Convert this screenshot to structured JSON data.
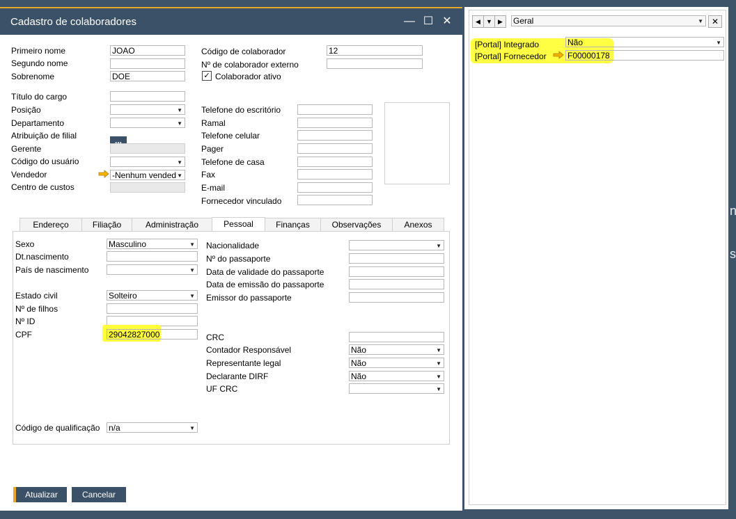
{
  "window": {
    "title": "Cadastro de colaboradores"
  },
  "left_fields": {
    "first_name": {
      "label": "Primeiro nome",
      "value": "JOAO"
    },
    "middle_name": {
      "label": "Segundo nome",
      "value": ""
    },
    "last_name": {
      "label": "Sobrenome",
      "value": "DOE"
    },
    "job_title": {
      "label": "Título do cargo",
      "value": ""
    },
    "position": {
      "label": "Posição",
      "value": ""
    },
    "department": {
      "label": "Departamento",
      "value": ""
    },
    "branch": {
      "label": "Atribuição de filial",
      "button": "..."
    },
    "manager": {
      "label": "Gerente",
      "value": ""
    },
    "user_code": {
      "label": "Código do usuário",
      "value": ""
    },
    "salesperson": {
      "label": "Vendedor",
      "value": "-Nenhum vended"
    },
    "cost_center": {
      "label": "Centro de custos",
      "value": ""
    }
  },
  "right_fields": {
    "employee_code": {
      "label": "Código de colaborador",
      "value": "12"
    },
    "external_no": {
      "label": "Nº de colaborador externo",
      "value": ""
    },
    "active": {
      "label": "Colaborador ativo",
      "checked": true
    },
    "office_phone": {
      "label": "Telefone do escritório",
      "value": ""
    },
    "extension": {
      "label": "Ramal",
      "value": ""
    },
    "mobile": {
      "label": "Telefone celular",
      "value": ""
    },
    "pager": {
      "label": "Pager",
      "value": ""
    },
    "home_phone": {
      "label": "Telefone de casa",
      "value": ""
    },
    "fax": {
      "label": "Fax",
      "value": ""
    },
    "email": {
      "label": "E-mail",
      "value": ""
    },
    "linked_vendor": {
      "label": "Fornecedor vinculado",
      "value": ""
    }
  },
  "tabs": [
    "Endereço",
    "Filiação",
    "Administração",
    "Pessoal",
    "Finanças",
    "Observações",
    "Anexos"
  ],
  "active_tab": "Pessoal",
  "personal_left": {
    "sex": {
      "label": "Sexo",
      "value": "Masculino"
    },
    "birth_date": {
      "label": "Dt.nascimento",
      "value": ""
    },
    "birth_country": {
      "label": "País de nascimento",
      "value": ""
    },
    "marital_status": {
      "label": "Estado civil",
      "value": "Solteiro"
    },
    "children": {
      "label": "Nº de filhos",
      "value": ""
    },
    "id_no": {
      "label": "Nº ID",
      "value": ""
    },
    "cpf": {
      "label": "CPF",
      "value": "29042827000"
    },
    "qualification_code": {
      "label": "Código de qualificação",
      "value": "n/a"
    }
  },
  "personal_right": {
    "nationality": {
      "label": "Nacionalidade",
      "value": ""
    },
    "passport_no": {
      "label": "Nº do passaporte",
      "value": ""
    },
    "passport_expiry": {
      "label": "Data de validade do passaporte",
      "value": ""
    },
    "passport_issue": {
      "label": "Data de emissão do passaporte",
      "value": ""
    },
    "passport_issuer": {
      "label": "Emissor do passaporte",
      "value": ""
    },
    "crc": {
      "label": "CRC",
      "value": ""
    },
    "accountant": {
      "label": "Contador Responsável",
      "value": "Não"
    },
    "legal_rep": {
      "label": "Representante legal",
      "value": "Não"
    },
    "dirf": {
      "label": "Declarante DIRF",
      "value": "Não"
    },
    "uf_crc": {
      "label": "UF CRC",
      "value": ""
    }
  },
  "buttons": {
    "update": "Atualizar",
    "cancel": "Cancelar"
  },
  "udf_pane": {
    "category": "Geral",
    "portal_integrated": {
      "label": "[Portal] Integrado",
      "value": "Não"
    },
    "portal_vendor": {
      "label": "[Portal] Fornecedor",
      "value": "F00000178"
    }
  },
  "colors": {
    "titlebar": "#3a5168",
    "accent": "#e8a82a",
    "highlight": "#ffff3a",
    "desktop": "#3e5468"
  }
}
